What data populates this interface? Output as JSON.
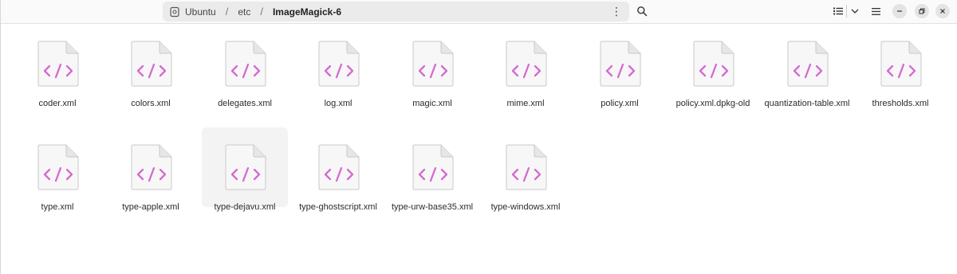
{
  "header": {
    "path": [
      "Ubuntu",
      "etc",
      "ImageMagick-6"
    ]
  },
  "icons": {
    "home": "drive-icon",
    "path_menu": "vertical-ellipsis-icon",
    "search": "search-icon",
    "view": "list-view-icon",
    "view_options": "chevron-down-icon",
    "menu": "hamburger-menu-icon",
    "minimize": "minimize-icon",
    "maximize": "restore-icon",
    "close": "close-icon",
    "file": "xml-file-icon"
  },
  "colors": {
    "xml_accent": "#d46bd0",
    "file_body": "#f7f7f7"
  },
  "files": [
    {
      "name": "coder.xml"
    },
    {
      "name": "colors.xml"
    },
    {
      "name": "delegates.xml"
    },
    {
      "name": "log.xml"
    },
    {
      "name": "magic.xml"
    },
    {
      "name": "mime.xml"
    },
    {
      "name": "policy.xml"
    },
    {
      "name": "policy.xml.dpkg-old"
    },
    {
      "name": "quantization-table.xml"
    },
    {
      "name": "thresholds.xml"
    },
    {
      "name": "type.xml"
    },
    {
      "name": "type-apple.xml"
    },
    {
      "name": "type-dejavu.xml",
      "selected": true
    },
    {
      "name": "type-ghostscript.xml"
    },
    {
      "name": "type-urw-base35.xml"
    },
    {
      "name": "type-windows.xml"
    }
  ]
}
